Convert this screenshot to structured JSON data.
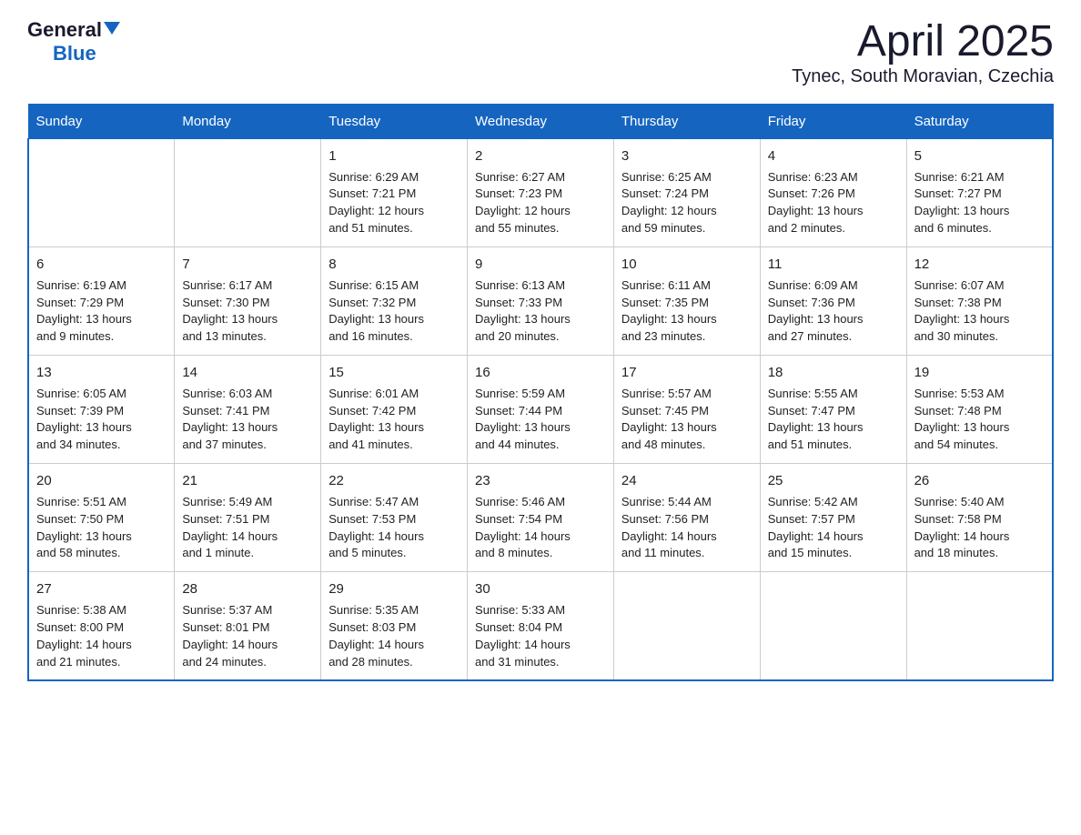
{
  "header": {
    "logo_general": "General",
    "logo_triangle": "▼",
    "logo_blue": "Blue",
    "title": "April 2025",
    "subtitle": "Tynec, South Moravian, Czechia"
  },
  "days_of_week": [
    "Sunday",
    "Monday",
    "Tuesday",
    "Wednesday",
    "Thursday",
    "Friday",
    "Saturday"
  ],
  "weeks": [
    [
      {
        "day": "",
        "info": ""
      },
      {
        "day": "",
        "info": ""
      },
      {
        "day": "1",
        "info": "Sunrise: 6:29 AM\nSunset: 7:21 PM\nDaylight: 12 hours\nand 51 minutes."
      },
      {
        "day": "2",
        "info": "Sunrise: 6:27 AM\nSunset: 7:23 PM\nDaylight: 12 hours\nand 55 minutes."
      },
      {
        "day": "3",
        "info": "Sunrise: 6:25 AM\nSunset: 7:24 PM\nDaylight: 12 hours\nand 59 minutes."
      },
      {
        "day": "4",
        "info": "Sunrise: 6:23 AM\nSunset: 7:26 PM\nDaylight: 13 hours\nand 2 minutes."
      },
      {
        "day": "5",
        "info": "Sunrise: 6:21 AM\nSunset: 7:27 PM\nDaylight: 13 hours\nand 6 minutes."
      }
    ],
    [
      {
        "day": "6",
        "info": "Sunrise: 6:19 AM\nSunset: 7:29 PM\nDaylight: 13 hours\nand 9 minutes."
      },
      {
        "day": "7",
        "info": "Sunrise: 6:17 AM\nSunset: 7:30 PM\nDaylight: 13 hours\nand 13 minutes."
      },
      {
        "day": "8",
        "info": "Sunrise: 6:15 AM\nSunset: 7:32 PM\nDaylight: 13 hours\nand 16 minutes."
      },
      {
        "day": "9",
        "info": "Sunrise: 6:13 AM\nSunset: 7:33 PM\nDaylight: 13 hours\nand 20 minutes."
      },
      {
        "day": "10",
        "info": "Sunrise: 6:11 AM\nSunset: 7:35 PM\nDaylight: 13 hours\nand 23 minutes."
      },
      {
        "day": "11",
        "info": "Sunrise: 6:09 AM\nSunset: 7:36 PM\nDaylight: 13 hours\nand 27 minutes."
      },
      {
        "day": "12",
        "info": "Sunrise: 6:07 AM\nSunset: 7:38 PM\nDaylight: 13 hours\nand 30 minutes."
      }
    ],
    [
      {
        "day": "13",
        "info": "Sunrise: 6:05 AM\nSunset: 7:39 PM\nDaylight: 13 hours\nand 34 minutes."
      },
      {
        "day": "14",
        "info": "Sunrise: 6:03 AM\nSunset: 7:41 PM\nDaylight: 13 hours\nand 37 minutes."
      },
      {
        "day": "15",
        "info": "Sunrise: 6:01 AM\nSunset: 7:42 PM\nDaylight: 13 hours\nand 41 minutes."
      },
      {
        "day": "16",
        "info": "Sunrise: 5:59 AM\nSunset: 7:44 PM\nDaylight: 13 hours\nand 44 minutes."
      },
      {
        "day": "17",
        "info": "Sunrise: 5:57 AM\nSunset: 7:45 PM\nDaylight: 13 hours\nand 48 minutes."
      },
      {
        "day": "18",
        "info": "Sunrise: 5:55 AM\nSunset: 7:47 PM\nDaylight: 13 hours\nand 51 minutes."
      },
      {
        "day": "19",
        "info": "Sunrise: 5:53 AM\nSunset: 7:48 PM\nDaylight: 13 hours\nand 54 minutes."
      }
    ],
    [
      {
        "day": "20",
        "info": "Sunrise: 5:51 AM\nSunset: 7:50 PM\nDaylight: 13 hours\nand 58 minutes."
      },
      {
        "day": "21",
        "info": "Sunrise: 5:49 AM\nSunset: 7:51 PM\nDaylight: 14 hours\nand 1 minute."
      },
      {
        "day": "22",
        "info": "Sunrise: 5:47 AM\nSunset: 7:53 PM\nDaylight: 14 hours\nand 5 minutes."
      },
      {
        "day": "23",
        "info": "Sunrise: 5:46 AM\nSunset: 7:54 PM\nDaylight: 14 hours\nand 8 minutes."
      },
      {
        "day": "24",
        "info": "Sunrise: 5:44 AM\nSunset: 7:56 PM\nDaylight: 14 hours\nand 11 minutes."
      },
      {
        "day": "25",
        "info": "Sunrise: 5:42 AM\nSunset: 7:57 PM\nDaylight: 14 hours\nand 15 minutes."
      },
      {
        "day": "26",
        "info": "Sunrise: 5:40 AM\nSunset: 7:58 PM\nDaylight: 14 hours\nand 18 minutes."
      }
    ],
    [
      {
        "day": "27",
        "info": "Sunrise: 5:38 AM\nSunset: 8:00 PM\nDaylight: 14 hours\nand 21 minutes."
      },
      {
        "day": "28",
        "info": "Sunrise: 5:37 AM\nSunset: 8:01 PM\nDaylight: 14 hours\nand 24 minutes."
      },
      {
        "day": "29",
        "info": "Sunrise: 5:35 AM\nSunset: 8:03 PM\nDaylight: 14 hours\nand 28 minutes."
      },
      {
        "day": "30",
        "info": "Sunrise: 5:33 AM\nSunset: 8:04 PM\nDaylight: 14 hours\nand 31 minutes."
      },
      {
        "day": "",
        "info": ""
      },
      {
        "day": "",
        "info": ""
      },
      {
        "day": "",
        "info": ""
      }
    ]
  ]
}
